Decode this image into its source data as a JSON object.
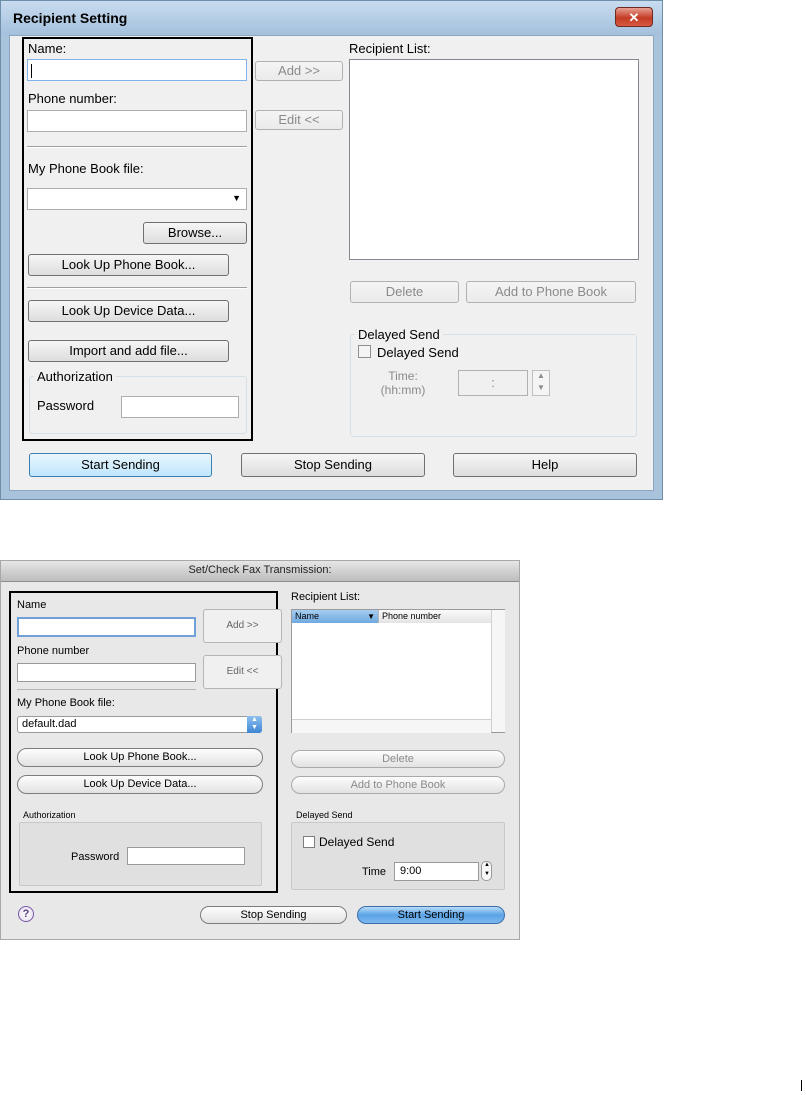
{
  "windows_dialog": {
    "title": "Recipient Setting",
    "close_glyph": "✕",
    "name_label": "Name:",
    "name_value": "",
    "phone_label": "Phone number:",
    "phone_value": "",
    "phonebook_file_label": "My Phone Book file:",
    "phonebook_file_value": "",
    "browse_label": "Browse...",
    "lookup_phonebook_label": "Look Up Phone Book...",
    "lookup_device_label": "Look Up Device Data...",
    "import_label": "Import and add file...",
    "authorization_label": "Authorization",
    "password_label": "Password",
    "password_value": "",
    "add_label": "Add >>",
    "edit_label": "Edit <<",
    "recipient_list_label": "Recipient List:",
    "delete_label": "Delete",
    "add_to_phonebook_label": "Add to Phone Book",
    "delayed_group_label": "Delayed Send",
    "delayed_checkbox_label": "Delayed Send",
    "delayed_checked": false,
    "time_label": "Time:",
    "time_format_label": "(hh:mm)",
    "time_value": ":",
    "start_label": "Start Sending",
    "stop_label": "Stop Sending",
    "help_label": "Help"
  },
  "mac_dialog": {
    "title": "Set/Check Fax Transmission:",
    "name_label": "Name",
    "name_value": "",
    "phone_label": "Phone number",
    "phone_value": "",
    "add_label": "Add >>",
    "edit_label": "Edit <<",
    "recipient_list_label": "Recipient List:",
    "list_columns": [
      "Name",
      "Phone number"
    ],
    "phonebook_file_label": "My Phone Book file:",
    "phonebook_file_value": "default.dad",
    "lookup_phonebook_label": "Look Up Phone Book...",
    "lookup_device_label": "Look Up Device Data...",
    "delete_label": "Delete",
    "add_to_phonebook_label": "Add to Phone Book",
    "authorization_label": "Authorization",
    "password_label": "Password",
    "password_value": "",
    "delayed_group_label": "Delayed Send",
    "delayed_checkbox_label": "Delayed Send",
    "delayed_checked": false,
    "time_label": "Time",
    "time_value": "9:00",
    "help_glyph": "?",
    "stop_label": "Stop Sending",
    "start_label": "Start Sending"
  },
  "colors": {
    "win_frame": "#a9c3dc",
    "win_close": "#c43b25",
    "mac_default_button": "#5aa3e6"
  }
}
